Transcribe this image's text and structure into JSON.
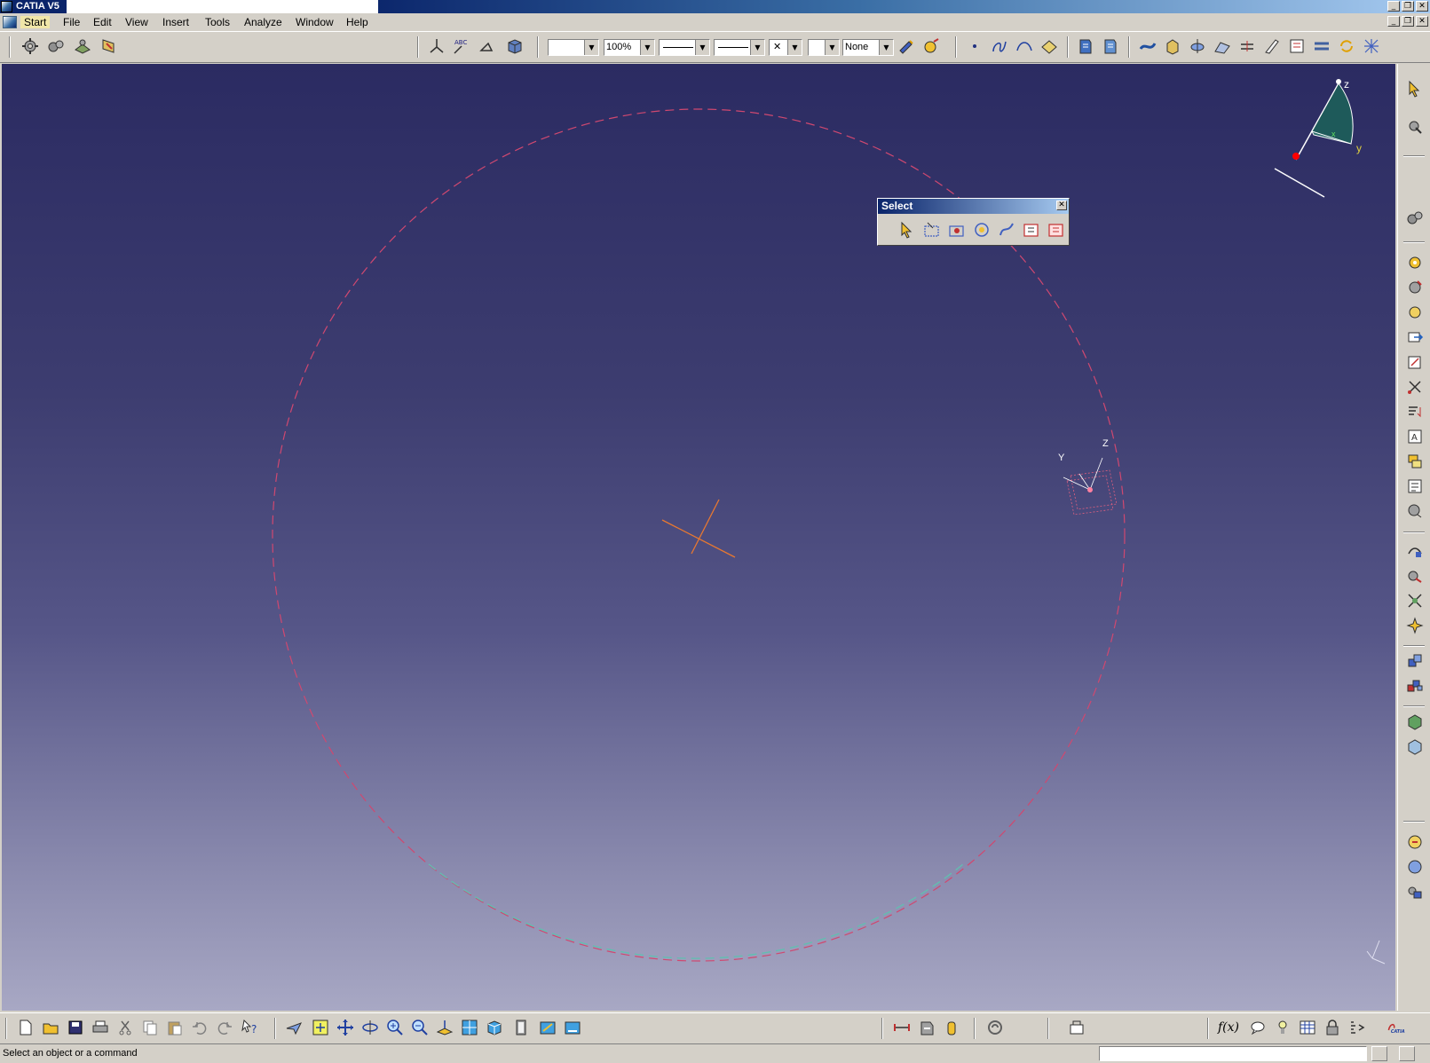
{
  "window": {
    "title": "CATIA V5"
  },
  "menubar": {
    "items": [
      "Start",
      "File",
      "Edit",
      "View",
      "Insert",
      "Tools",
      "Analyze",
      "Window",
      "Help"
    ]
  },
  "toolbar_top": {
    "fill_color_value": "",
    "transparency_value": "100%",
    "line_thickness_value": "",
    "line_type_value": "",
    "point_type_value": "",
    "layer_value": "",
    "layer_filter_value": "None",
    "icons": [
      "product-gear-icon",
      "gears-icon",
      "workbench-icon",
      "catalog-icon",
      "axis-system-icon",
      "abc-annotation-icon",
      "measure-icon",
      "shaded-cube-icon",
      "painter-icon",
      "color-bulb-icon",
      "point-icon",
      "spline-icon",
      "curve-icon",
      "plane-icon",
      "catalog-book-icon",
      "catalog-book2-icon",
      "surface-icon",
      "extrude-icon",
      "revolve-icon",
      "sweep-icon",
      "offset-icon",
      "draft-icon",
      "filter-icon",
      "fillet-icon",
      "update-icon",
      "multi-section-icon"
    ]
  },
  "viewport": {
    "compass": {
      "labels": [
        "z",
        "y",
        "x"
      ]
    },
    "axis_labels": [
      "Y",
      "Z"
    ],
    "colors": {
      "circle_dash": "#d04870",
      "circle_teal": "#60c0b0",
      "crosshair": "#e87830",
      "compass": "#ffffff",
      "compass_red_dot": "#ff0000"
    }
  },
  "select_panel": {
    "title": "Select",
    "tools": [
      "select-arrow-icon",
      "selection-trap-icon",
      "intersecting-trap-icon",
      "polygon-trap-icon",
      "paint-stroke-icon",
      "outside-trap-icon",
      "intersecting-outside-icon"
    ]
  },
  "right_toolbar": {
    "icons": [
      "select-pointer-icon",
      "selection-mode-icon",
      "product-gear-icon",
      "gear-settings-icon",
      "gear-refresh-icon",
      "gear-update-icon",
      "export-icon",
      "insert-sketch-icon",
      "cut-icon",
      "sort-icon",
      "text-box-icon",
      "yellow-stack-icon",
      "tree-icon",
      "gear-down-icon",
      "move-icon",
      "manipulate-icon",
      "snap-icon",
      "explode-icon",
      "multi-instance-icon",
      "fast-multi-instance-icon",
      "bill-of-materials-icon",
      "scene-icon",
      "render-icon",
      "sphere-icon",
      "assembly-icon"
    ]
  },
  "toolbar_bottom": {
    "icons": [
      "new-icon",
      "open-icon",
      "save-icon",
      "print-icon",
      "cut-icon",
      "copy-icon",
      "paste-icon",
      "undo-icon",
      "redo-icon",
      "whats-this-icon",
      "fly-mode-icon",
      "fit-all-icon",
      "pan-icon",
      "rotate-icon",
      "zoom-in-icon",
      "zoom-out-icon",
      "normal-view-icon",
      "multi-view-icon",
      "iso-view-icon",
      "shading-icon",
      "hide-show-icon",
      "swap-space-icon",
      "measure-between-icon",
      "measure-item-icon",
      "measure-inertia-icon",
      "knowledge-icon",
      "sketch-analysis-icon",
      "formula-icon",
      "comment-icon",
      "light-icon",
      "table-icon",
      "lock-icon",
      "equalizer-icon",
      "catia-logo-icon"
    ],
    "formula_label": "f(x)"
  },
  "statusbar": {
    "message": "Select an object or a command"
  }
}
